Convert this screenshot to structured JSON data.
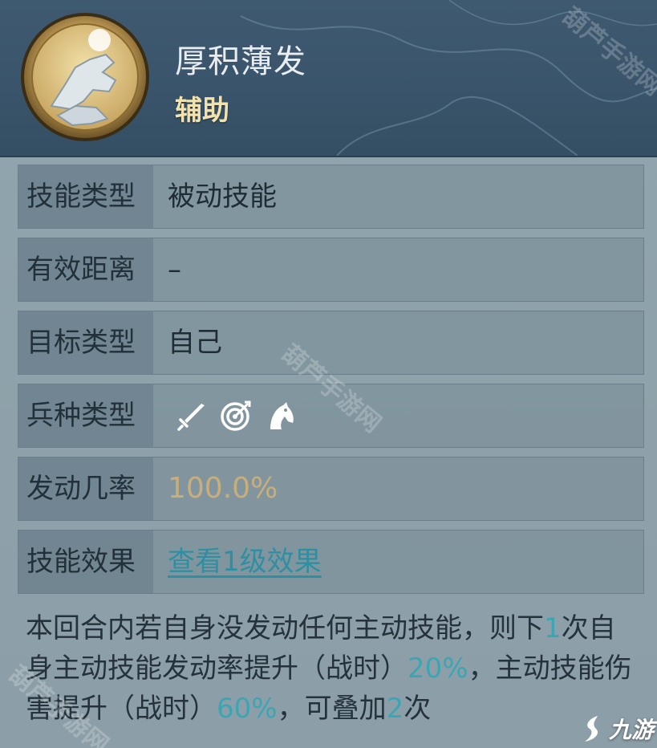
{
  "header": {
    "title": "厚积薄发",
    "category": "辅助"
  },
  "rows": [
    {
      "label": "技能类型",
      "value": "被动技能"
    },
    {
      "label": "有效距离",
      "value": "–"
    },
    {
      "label": "目标类型",
      "value": "自己"
    },
    {
      "label": "兵种类型",
      "icons": [
        "sword-icon",
        "archery-target-icon",
        "horse-head-icon"
      ]
    },
    {
      "label": "发动几率",
      "value": "100.0%"
    },
    {
      "label": "技能效果",
      "value": "查看1级效果"
    }
  ],
  "description": {
    "p1": "本回合内若自身没发动任何主动技能，则下",
    "v1": "1",
    "p2": "次自身主动技能发动率提升（战时）",
    "v2": "20%",
    "p3": "，主动技能伤害提升（战时）",
    "v3": "60%",
    "p4": "，可叠加",
    "v4": "2",
    "p5": "次"
  },
  "watermarks": {
    "text": "葫芦手游网"
  },
  "logo": {
    "text": "九游"
  },
  "colors": {
    "header_bg": "#3a556b",
    "rate": "#c7ae7b",
    "link": "#2e8fa3",
    "highlight": "#3aa6b4",
    "category": "#f1e2b0"
  }
}
